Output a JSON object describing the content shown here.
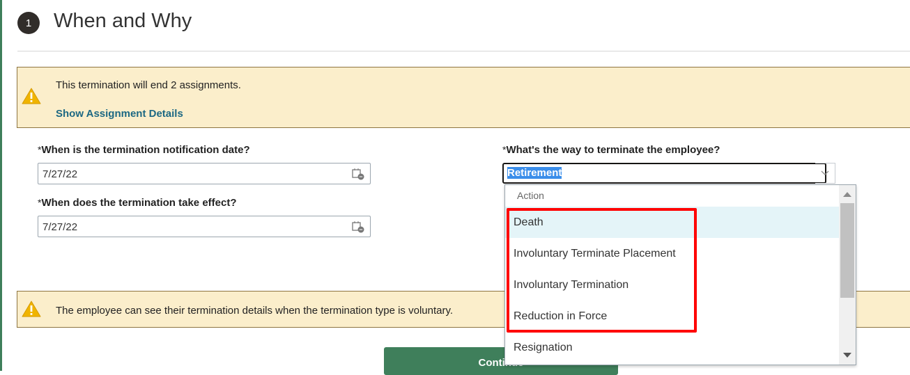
{
  "header": {
    "step_number": "1",
    "title": "When and Why"
  },
  "warning_assignments": {
    "message": "This termination will end 2 assignments.",
    "link": "Show Assignment Details"
  },
  "fields": {
    "notification_date": {
      "label": "When is the termination notification date?",
      "value": "7/27/22"
    },
    "effective_date": {
      "label": "When does the termination take effect?",
      "value": "7/27/22"
    },
    "termination_way": {
      "label": "What's the way to terminate the employee?",
      "value": "Retirement"
    }
  },
  "required_mark": "*",
  "dropdown": {
    "header": "Action",
    "options": [
      "Death",
      "Involuntary Terminate Placement",
      "Involuntary Termination",
      "Reduction in Force",
      "Resignation"
    ],
    "highlighted": "Death"
  },
  "warning_voluntary": {
    "message": "The employee can see their termination details when the termination type is voluntary."
  },
  "continue_button": "Continue",
  "colors": {
    "accent": "#3f7f5b",
    "warning_bg": "#fbeecb",
    "link": "#1d6883",
    "highlight": "#e4f4f8",
    "annotation": "#ff0000"
  }
}
